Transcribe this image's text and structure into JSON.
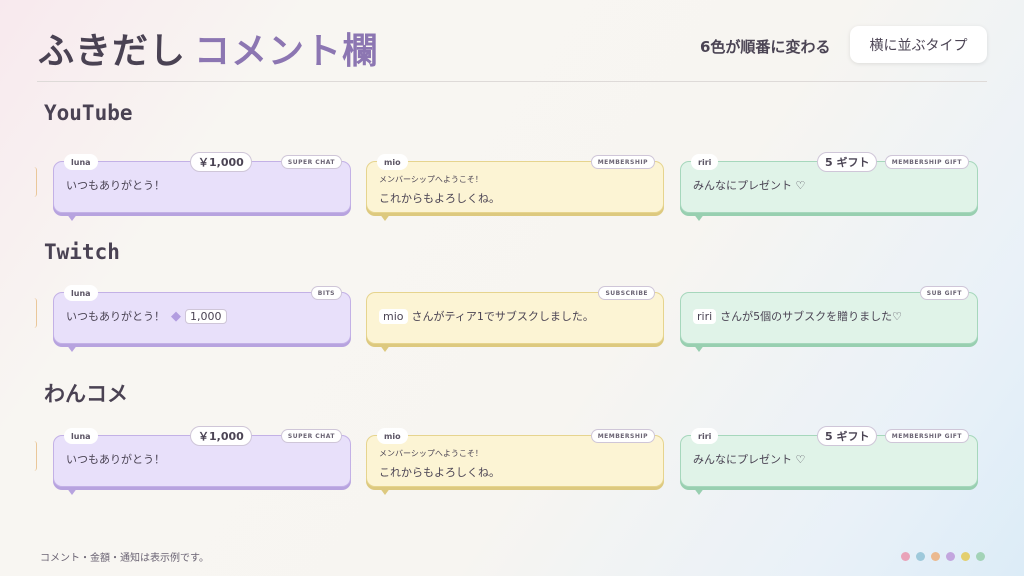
{
  "header": {
    "title_part1": "ふきだし",
    "title_part2": "コメント欄",
    "subtitle": "6色が順番に変わる",
    "type_button": "横に並ぶタイプ"
  },
  "sections": [
    {
      "title": "YouTube",
      "cards": [
        {
          "color": "purple",
          "user": "luna",
          "amount": "￥1,000",
          "tag": "SUPER CHAT",
          "message": "いつもありがとう！"
        },
        {
          "color": "yellow",
          "user": "mio",
          "tag": "MEMBERSHIP",
          "small": "メンバーシップへようこそ！",
          "message": "これからもよろしくね。"
        },
        {
          "color": "green",
          "user": "riri",
          "amount": "5 ギフト",
          "tag": "MEMBERSHIP GIFT",
          "message": "みんなにプレゼント ♡"
        }
      ]
    },
    {
      "title": "Twitch",
      "cards": [
        {
          "color": "purple",
          "user": "luna",
          "tag": "BITS",
          "message": "いつもありがとう！",
          "bits_icon": "◆",
          "bits": "1,000"
        },
        {
          "color": "yellow",
          "tag": "SUBSCRIBE",
          "inline_user": "mio",
          "message": "さんがティア1でサブスクしました。"
        },
        {
          "color": "green",
          "tag": "SUB GIFT",
          "inline_user": "riri",
          "message": "さんが5個のサブスクを贈りました♡"
        }
      ]
    },
    {
      "title": "わんコメ",
      "cards": [
        {
          "color": "purple",
          "user": "luna",
          "amount": "￥1,000",
          "tag": "SUPER CHAT",
          "message": "いつもありがとう！"
        },
        {
          "color": "yellow",
          "user": "mio",
          "tag": "MEMBERSHIP",
          "small": "メンバーシップへようこそ！",
          "message": "これからもよろしくね。"
        },
        {
          "color": "green",
          "user": "riri",
          "amount": "5 ギフト",
          "tag": "MEMBERSHIP GIFT",
          "message": "みんなにプレゼント ♡"
        }
      ]
    }
  ],
  "footer": {
    "note": "コメント・金額・通知は表示例です。",
    "dot_colors": [
      "#e9a3b9",
      "#9ec9db",
      "#ebb98f",
      "#c3a6de",
      "#e3cf6e",
      "#a3d3b7"
    ]
  }
}
